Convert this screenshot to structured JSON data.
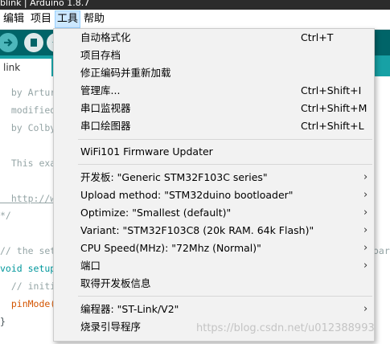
{
  "window": {
    "title": "blink | Arduino 1.8.7"
  },
  "menubar": {
    "items": [
      {
        "label": "编辑"
      },
      {
        "label": "项目"
      },
      {
        "label": "工具"
      },
      {
        "label": "帮助"
      }
    ]
  },
  "tab": {
    "label": "link"
  },
  "code": {
    "lines": [
      "  by Artur",
      "  modified",
      "  by Colby",
      "  This exa",
      "  http://w",
      "*/",
      "// the set",
      "void setup",
      "  // initi",
      "  pinMode(",
      "}"
    ],
    "overflow_text": "oar"
  },
  "tools_menu": {
    "auto_format": {
      "label": "自动格式化",
      "shortcut": "Ctrl+T"
    },
    "archive_sketch": {
      "label": "项目存档"
    },
    "fix_encoding": {
      "label": "修正编码并重新加载"
    },
    "manage_libraries": {
      "label": "管理库...",
      "shortcut": "Ctrl+Shift+I"
    },
    "serial_monitor": {
      "label": "串口监视器",
      "shortcut": "Ctrl+Shift+M"
    },
    "serial_plotter": {
      "label": "串口绘图器",
      "shortcut": "Ctrl+Shift+L"
    },
    "wifi_updater": {
      "label": "WiFi101 Firmware Updater"
    },
    "board": {
      "label": "开发板: \"Generic STM32F103C series\""
    },
    "upload_method": {
      "label": "Upload method: \"STM32duino bootloader\""
    },
    "optimize": {
      "label": "Optimize: \"Smallest (default)\""
    },
    "variant": {
      "label": "Variant: \"STM32F103C8 (20k RAM. 64k Flash)\""
    },
    "cpu_speed": {
      "label": "CPU Speed(MHz): \"72Mhz (Normal)\""
    },
    "port": {
      "label": "端口"
    },
    "board_info": {
      "label": "取得开发板信息"
    },
    "programmer": {
      "label": "编程器: \"ST-Link/V2\""
    },
    "burn_bootloader": {
      "label": "烧录引导程序"
    },
    "submenu_arrow": "›"
  },
  "watermark": {
    "text": "https://blog.csdn.net/u012388993"
  }
}
